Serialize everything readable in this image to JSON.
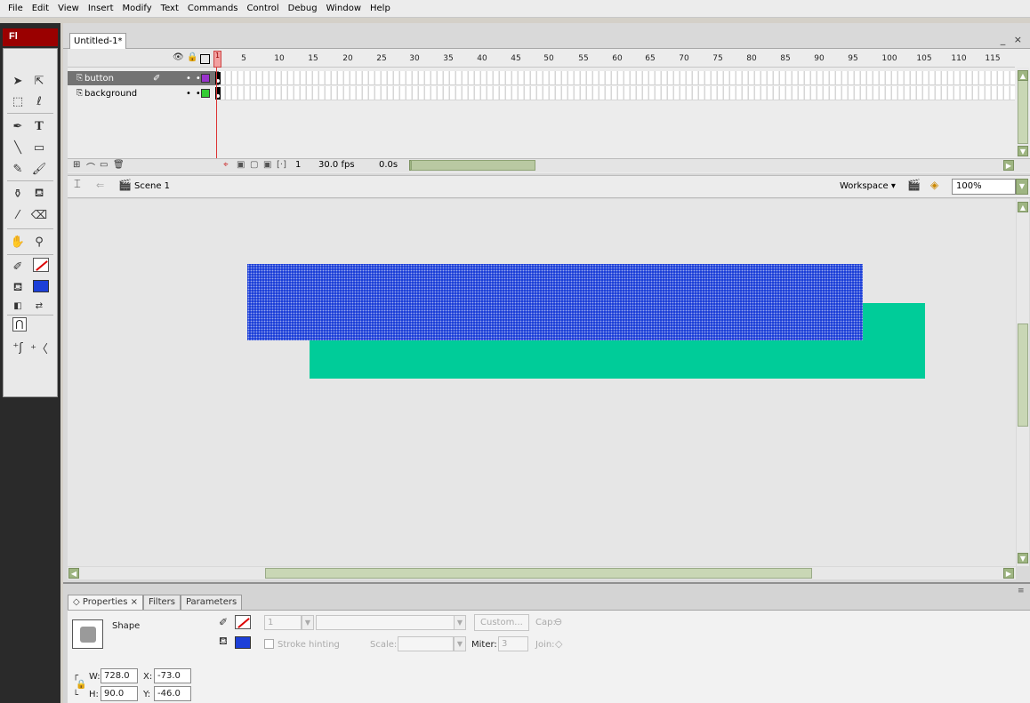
{
  "menu": [
    "File",
    "Edit",
    "View",
    "Insert",
    "Modify",
    "Text",
    "Commands",
    "Control",
    "Debug",
    "Window",
    "Help"
  ],
  "app_logo": "Fl",
  "doc_tab": "Untitled-1*",
  "window_controls": "_ ×",
  "panel_collapse": "«",
  "layers": [
    {
      "name": "button",
      "color": "#9933cc",
      "selected": true
    },
    {
      "name": "background",
      "color": "#33cc33",
      "selected": false
    }
  ],
  "ruler_numbers": [
    "1",
    "5",
    "10",
    "15",
    "20",
    "25",
    "30",
    "35",
    "40",
    "45",
    "50",
    "55",
    "60",
    "65",
    "70",
    "75",
    "80",
    "85",
    "90",
    "95",
    "100",
    "105",
    "110",
    "115"
  ],
  "timeline_status": {
    "frame": "1",
    "fps": "30.0 fps",
    "time": "0.0s"
  },
  "edit_bar": {
    "scene": "Scene 1",
    "workspace": "Workspace ▾",
    "zoom": "100%"
  },
  "stage_shapes": {
    "blue_fill": "#1c3fd8",
    "green_fill": "#00cc99"
  },
  "properties": {
    "tabs": [
      "Properties ×",
      "Filters",
      "Parameters"
    ],
    "type_label": "Shape",
    "stroke_height": "1",
    "custom_button": "Custom...",
    "cap_label": "Cap:",
    "stroke_hinting": "Stroke hinting",
    "scale_label": "Scale:",
    "miter_label": "Miter:",
    "miter_value": "3",
    "join_label": "Join:",
    "w_label": "W:",
    "w_value": "728.0",
    "h_label": "H:",
    "h_value": "90.0",
    "x_label": "X:",
    "x_value": "-73.0",
    "y_label": "Y:",
    "y_value": "-46.0"
  }
}
